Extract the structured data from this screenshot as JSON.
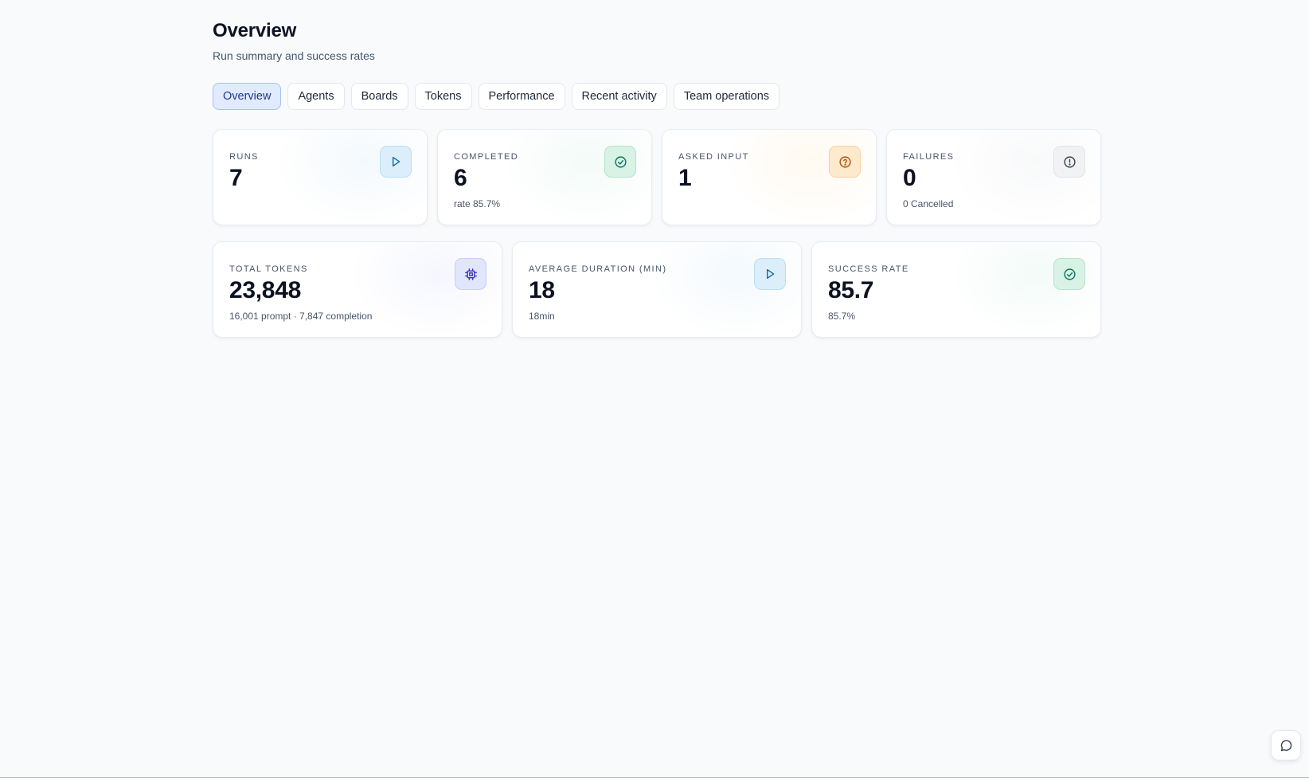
{
  "header": {
    "title": "Overview",
    "subtitle": "Run summary and success rates"
  },
  "tabs": [
    {
      "label": "Overview",
      "active": true
    },
    {
      "label": "Agents",
      "active": false
    },
    {
      "label": "Boards",
      "active": false
    },
    {
      "label": "Tokens",
      "active": false
    },
    {
      "label": "Performance",
      "active": false
    },
    {
      "label": "Recent activity",
      "active": false
    },
    {
      "label": "Team operations",
      "active": false
    }
  ],
  "stats_row1": [
    {
      "label": "RUNS",
      "value": "7",
      "sub": "",
      "icon": "play-icon",
      "color": "#0284c7"
    },
    {
      "label": "COMPLETED",
      "value": "6",
      "sub": "rate 85.7%",
      "icon": "check-circle-icon",
      "color": "#059669"
    },
    {
      "label": "ASKED INPUT",
      "value": "1",
      "sub": "",
      "icon": "help-circle-icon",
      "color": "#d97706"
    },
    {
      "label": "FAILURES",
      "value": "0",
      "sub": "0 Cancelled",
      "icon": "alert-circle-icon",
      "color": "#475569"
    }
  ],
  "stats_row2": [
    {
      "label": "TOTAL TOKENS",
      "value": "23,848",
      "sub": "16,001 prompt · 7,847 completion",
      "icon": "cpu-icon",
      "color": "#4f46e5"
    },
    {
      "label": "AVERAGE DURATION (MIN)",
      "value": "18",
      "sub": "18min",
      "icon": "play-icon",
      "color": "#0284c7"
    },
    {
      "label": "SUCCESS RATE",
      "value": "85.7",
      "sub": "85.7%",
      "icon": "check-circle-icon",
      "color": "#059669"
    }
  ]
}
